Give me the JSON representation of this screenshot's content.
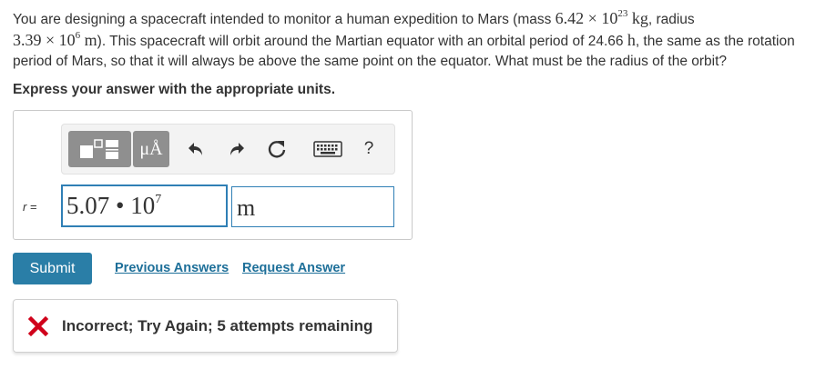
{
  "question": {
    "p1": "You are designing a spacecraft intended to monitor a human expedition to Mars (mass ",
    "mass_coef": "6.42",
    "times": " × ",
    "ten": "10",
    "mass_exp": "23",
    "mass_unit": " kg",
    "p2": ", radius ",
    "radius_coef": "3.39",
    "radius_exp": "6",
    "radius_unit": " m",
    "p3": "). This spacecraft will orbit around the Martian equator with an orbital period of 24.66 ",
    "period_unit": "h",
    "p4": ", the same as the rotation period of Mars, so that it will always be above the same point on the equator. What must be the radius of the orbit?"
  },
  "instruction": "Express your answer with the appropriate units.",
  "toolbar": {
    "units_button": "μÅ",
    "help_label": "?"
  },
  "answer": {
    "var_label": "r",
    "equals": " =",
    "value_coef": "5.07",
    "value_dot": " • ",
    "value_base": "10",
    "value_exp": "7",
    "unit": "m"
  },
  "actions": {
    "submit": "Submit",
    "previous_answers": "Previous Answers",
    "request_answer": "Request Answer"
  },
  "feedback": {
    "status": "incorrect",
    "text": "Incorrect; Try Again; 5 attempts remaining"
  },
  "colors": {
    "accent_blue": "#2a7ea7",
    "link_blue": "#1d6f99",
    "error_red": "#d0021b"
  }
}
